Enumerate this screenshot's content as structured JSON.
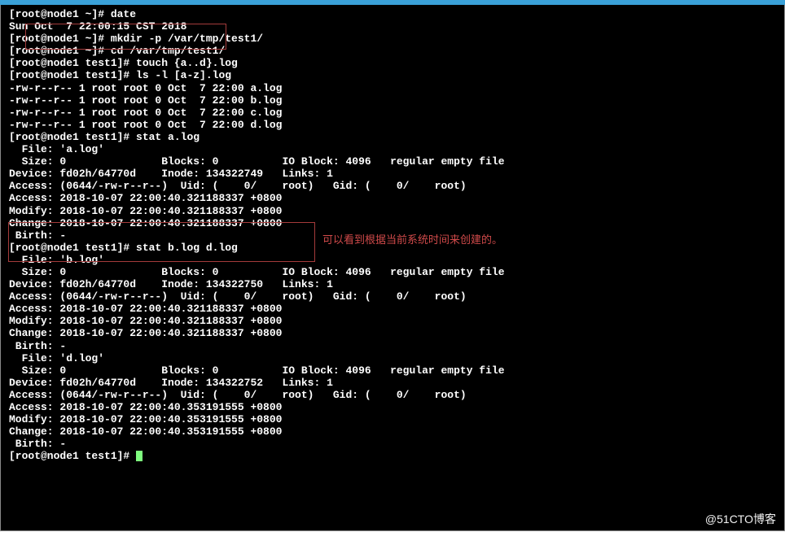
{
  "prompt_full": "[root@node1 ~]# ",
  "prompt_test": "[root@node1 test1]# ",
  "cmds": {
    "c0": "date",
    "c1": "mkdir -p /var/tmp/test1/",
    "c2": "cd /var/tmp/test1/",
    "c3": "touch {a..d}.log",
    "c4": "ls -l [a-z].log",
    "c5": "stat a.log",
    "c6": "stat b.log d.log"
  },
  "date_out": "Sun Oct  7 22:00:15 CST 2018",
  "ls": {
    "l0": "-rw-r--r-- 1 root root 0 Oct  7 22:00 a.log",
    "l1": "-rw-r--r-- 1 root root 0 Oct  7 22:00 b.log",
    "l2": "-rw-r--r-- 1 root root 0 Oct  7 22:00 c.log",
    "l3": "-rw-r--r-- 1 root root 0 Oct  7 22:00 d.log"
  },
  "stat_a": {
    "file": "  File: 'a.log'",
    "size": "  Size: 0               Blocks: 0          IO Block: 4096   regular empty file",
    "dev": "Device: fd02h/64770d    Inode: 134322749   Links: 1",
    "perm": "Access: (0644/-rw-r--r--)  Uid: (    0/    root)   Gid: (    0/    root)",
    "acc": "Access: 2018-10-07 22:00:40.321188337 +0800",
    "mod": "Modify: 2018-10-07 22:00:40.321188337 +0800",
    "chg": "Change: 2018-10-07 22:00:40.321188337 +0800",
    "birth": " Birth: -"
  },
  "stat_b": {
    "file": "  File: 'b.log'",
    "size": "  Size: 0               Blocks: 0          IO Block: 4096   regular empty file",
    "dev": "Device: fd02h/64770d    Inode: 134322750   Links: 1",
    "perm": "Access: (0644/-rw-r--r--)  Uid: (    0/    root)   Gid: (    0/    root)",
    "acc": "Access: 2018-10-07 22:00:40.321188337 +0800",
    "mod": "Modify: 2018-10-07 22:00:40.321188337 +0800",
    "chg": "Change: 2018-10-07 22:00:40.321188337 +0800",
    "birth": " Birth: -"
  },
  "stat_d": {
    "file": "  File: 'd.log'",
    "size": "  Size: 0               Blocks: 0          IO Block: 4096   regular empty file",
    "dev": "Device: fd02h/64770d    Inode: 134322752   Links: 1",
    "perm": "Access: (0644/-rw-r--r--)  Uid: (    0/    root)   Gid: (    0/    root)",
    "acc": "Access: 2018-10-07 22:00:40.353191555 +0800",
    "mod": "Modify: 2018-10-07 22:00:40.353191555 +0800",
    "chg": "Change: 2018-10-07 22:00:40.353191555 +0800",
    "birth": " Birth: -"
  },
  "annotation": "可以看到根据当前系统时间来创建的。",
  "watermark": "@51CTO博客"
}
